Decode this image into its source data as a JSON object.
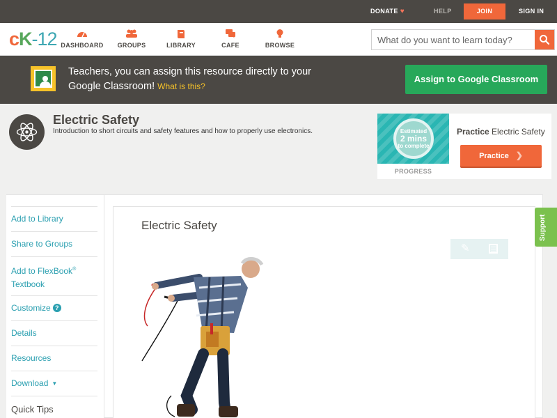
{
  "topbar": {
    "donate": "DONATE",
    "help": "HELP",
    "join": "JOIN",
    "signin": "SIGN IN"
  },
  "logo": {
    "c": "c",
    "k": "K",
    "dash": "-",
    "num": "12"
  },
  "nav": {
    "dashboard": "DASHBOARD",
    "groups": "GROUPS",
    "library": "LIBRARY",
    "cafe": "CAFE",
    "browse": "BROWSE"
  },
  "search": {
    "placeholder": "What do you want to learn today?"
  },
  "classroom": {
    "text": "Teachers, you can assign this resource directly to your Google Classroom!",
    "what": "What is this?",
    "button": "Assign to Google Classroom"
  },
  "concept": {
    "title": "Electric Safety",
    "description": "Introduction to short circuits and safety features and how to properly use electronics."
  },
  "practice": {
    "thumb_line1": "Estimated",
    "thumb_line2": "2 mins",
    "thumb_line3": "to complete",
    "progress_label": "PROGRESS",
    "title_bold": "Practice",
    "title_rest": "Electric Safety",
    "button": "Practice"
  },
  "sidebar": {
    "items": [
      "Add to Library",
      "Share to Groups",
      "Add to FlexBook",
      "Textbook",
      "Customize",
      "Details",
      "Resources",
      "Download",
      "Quick Tips"
    ],
    "registered": "®"
  },
  "panel": {
    "title": "Electric Safety"
  },
  "support": "Support",
  "colors": {
    "brand_orange": "#f0673a",
    "brand_green": "#27a85a",
    "teal": "#2a9fb0",
    "dark": "#4b4844"
  }
}
